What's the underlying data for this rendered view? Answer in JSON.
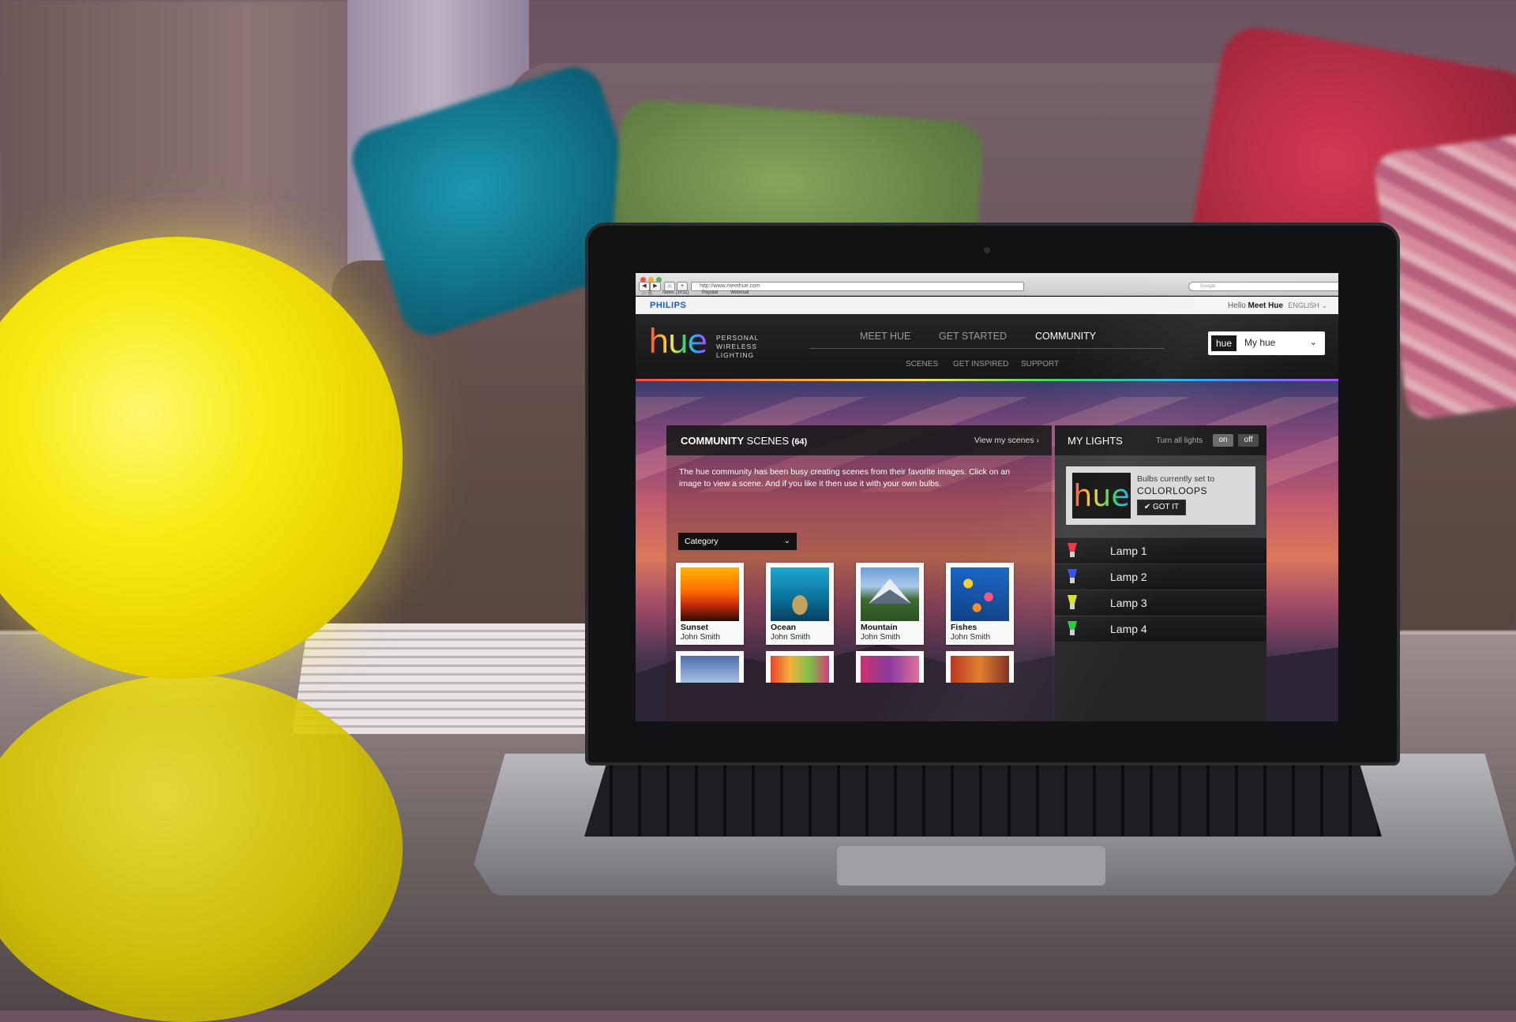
{
  "browser": {
    "url": "http://www.meethue.com",
    "search_placeholder": "Google",
    "bookmarks": [
      "News (1011)",
      "Popular",
      "Webmail"
    ]
  },
  "topbar": {
    "brand": "PHILIPS",
    "greeting": "Hello",
    "user": "Meet Hue",
    "language": "ENGLISH"
  },
  "nav": {
    "logo": "hue",
    "tagline": "PERSONAL\nWIRELESS\nLIGHTING",
    "main": [
      "MEET HUE",
      "GET STARTED",
      "COMMUNITY"
    ],
    "sub": [
      "SCENES",
      "GET INSPIRED",
      "SUPPORT"
    ],
    "active": "COMMUNITY",
    "account_logo": "hue",
    "account_label": "My hue"
  },
  "community": {
    "title_bold": "COMMUNITY",
    "title_light": "SCENES",
    "count": "(64)",
    "view_link": "View my scenes",
    "description": "The hue community has been busy creating scenes from their favorite images. Click on an image to view a scene. And if you like it then use it with your own bulbs.",
    "category_label": "Category",
    "scenes": [
      {
        "name": "Sunset",
        "author": "John Smith"
      },
      {
        "name": "Ocean",
        "author": "John Smith"
      },
      {
        "name": "Mountain",
        "author": "John Smith"
      },
      {
        "name": "Fishes",
        "author": "John Smith"
      }
    ]
  },
  "my_lights": {
    "title": "MY LIGHTS",
    "turn_all": "Turn all lights",
    "on_label": "on",
    "off_label": "off",
    "status_text": "Bulbs currently set to",
    "status_mode": "COLORLOOPS",
    "got_it": "GOT IT",
    "lamps": [
      {
        "label": "Lamp 1",
        "color": "#e8303b"
      },
      {
        "label": "Lamp 2",
        "color": "#2f4cff"
      },
      {
        "label": "Lamp 3",
        "color": "#d8e22a"
      },
      {
        "label": "Lamp 4",
        "color": "#26c93c"
      }
    ]
  }
}
